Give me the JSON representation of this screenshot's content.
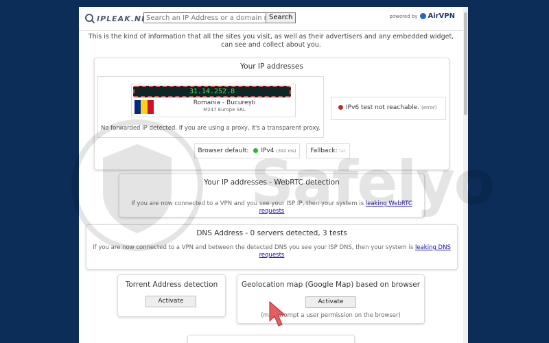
{
  "header": {
    "logo_text": "IPLEAK.NET",
    "search_placeholder": "Search an IP Address or a domain name",
    "search_button": "Search",
    "powered_by": "powered by",
    "brand": "AirVPN"
  },
  "intro": "This is the kind of information that all the sites you visit, as well as their advertisers and any embedded widget, can see and collect about you.",
  "ip_section": {
    "title": "Your IP addresses",
    "ip": "31.14.252.8",
    "location": "Romania - București",
    "isp": "M247 Europe SRL",
    "no_forward": "No forwarded IP detected. If you are using a proxy, it's a transparent proxy.",
    "ipv6_text": "IPv6 test not reachable.",
    "ipv6_error": "(error)",
    "browser_default_label": "Browser default:",
    "browser_default_value": "IPv4",
    "browser_default_ms": "(392 ms)",
    "fallback_label": "Fallback:",
    "fallback_value": "fail"
  },
  "webrtc": {
    "title": "Your IP addresses - WebRTC detection",
    "desc": "If you are now connected to a VPN and you see your ISP IP, then your system is",
    "link": "leaking WebRTC requests"
  },
  "dns": {
    "title": "DNS Address - 0 servers detected, 3 tests",
    "desc": "If you are now connected to a VPN and between the detected DNS you see your ISP DNS, then your system is",
    "link_part1": "leaking DNS",
    "link_part2": "requests"
  },
  "torrent": {
    "title": "Torrent Address detection",
    "button": "Activate"
  },
  "geo": {
    "title": "Geolocation map (Google Map) based on browser",
    "button": "Activate",
    "note": "(may prompt a user permission on the browser)"
  },
  "watermark": "Safelyo",
  "icons": {
    "logo": "magnifier-logo-icon",
    "flag": "romania-flag-icon",
    "cursor": "pointer-arrow-icon"
  },
  "colors": {
    "background": "#0c2d57",
    "ip_text": "#49e84a",
    "status_ok": "#2db52d",
    "status_error": "#c62828",
    "cursor": "#e55d5d"
  }
}
